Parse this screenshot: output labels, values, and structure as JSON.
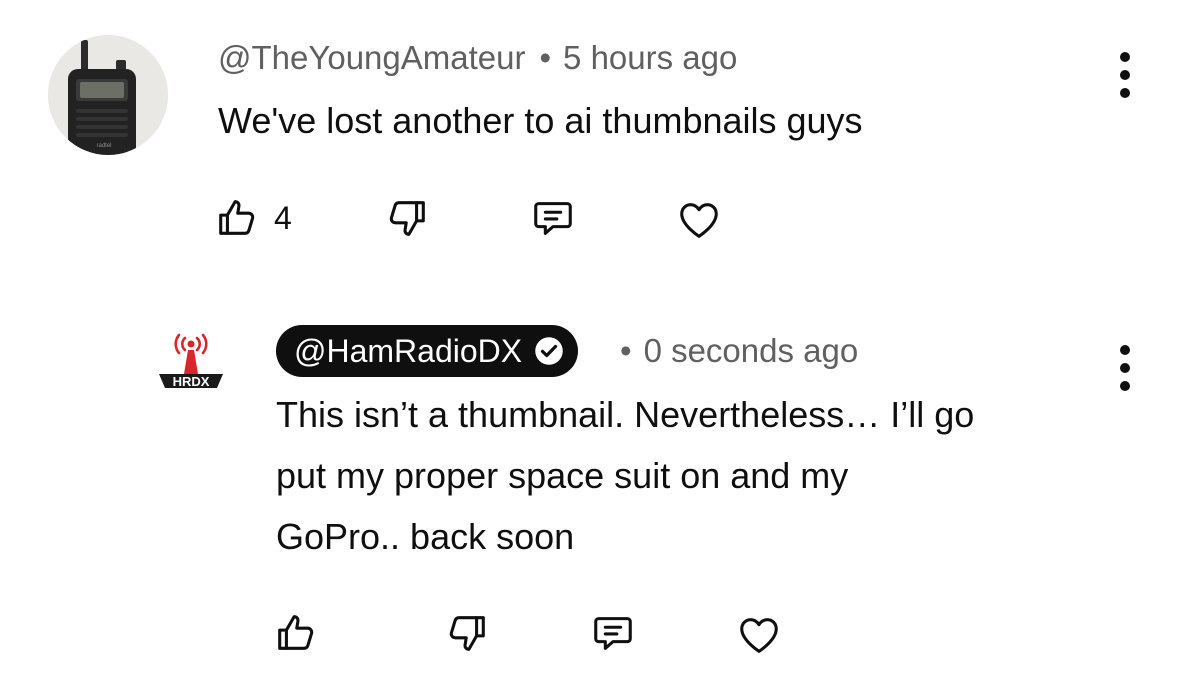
{
  "comment": {
    "handle": "@TheYoungAmateur",
    "separator": "•",
    "time": "5 hours ago",
    "text": "We've lost another to ai thumbnails guys",
    "like_count": "4",
    "avatar_icon": "walkie-talkie-avatar",
    "avatar_brand": "radtel"
  },
  "reply": {
    "handle": "@HamRadioDX",
    "verified": true,
    "separator": "•",
    "time": "0 seconds ago",
    "text_lines": [
      "This isn’t a thumbnail. Nevertheless… I’ll go",
      "put my proper space suit on and my",
      "GoPro.. back soon"
    ],
    "avatar_logo_text": "HRDX",
    "logo_accent": "#d8262b"
  },
  "actions": {
    "like_icon": "thumbs-up-icon",
    "dislike_icon": "thumbs-down-icon",
    "reply_icon": "comment-icon",
    "heart_icon": "heart-icon",
    "more_icon": "more-vertical-icon"
  }
}
